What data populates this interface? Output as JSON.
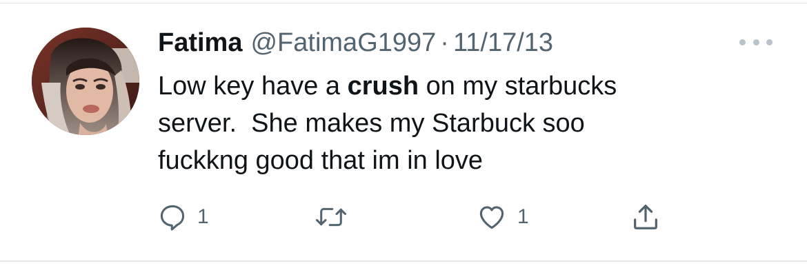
{
  "tweet": {
    "author": {
      "display_name": "Fatima",
      "handle": "@FatimaG1997",
      "separator": "·",
      "timestamp": "11/17/13"
    },
    "text": {
      "line1_before": "Low key have a ",
      "line1_bold": "crush",
      "line1_after": " on my starbucks",
      "line2": "server.  She makes my Starbuck soo",
      "line3": "fuckkng good that im in love"
    },
    "actions": {
      "reply_count": "1",
      "retweet_count": "",
      "like_count": "1"
    }
  },
  "icons": {
    "reply": "reply-bubble-icon",
    "retweet": "retweet-arrows-icon",
    "like": "heart-icon",
    "share": "share-upload-icon",
    "more": "more-dots-icon"
  },
  "colors": {
    "text_primary": "#0f1419",
    "text_secondary": "#536471",
    "divider": "#e6e9eb"
  }
}
